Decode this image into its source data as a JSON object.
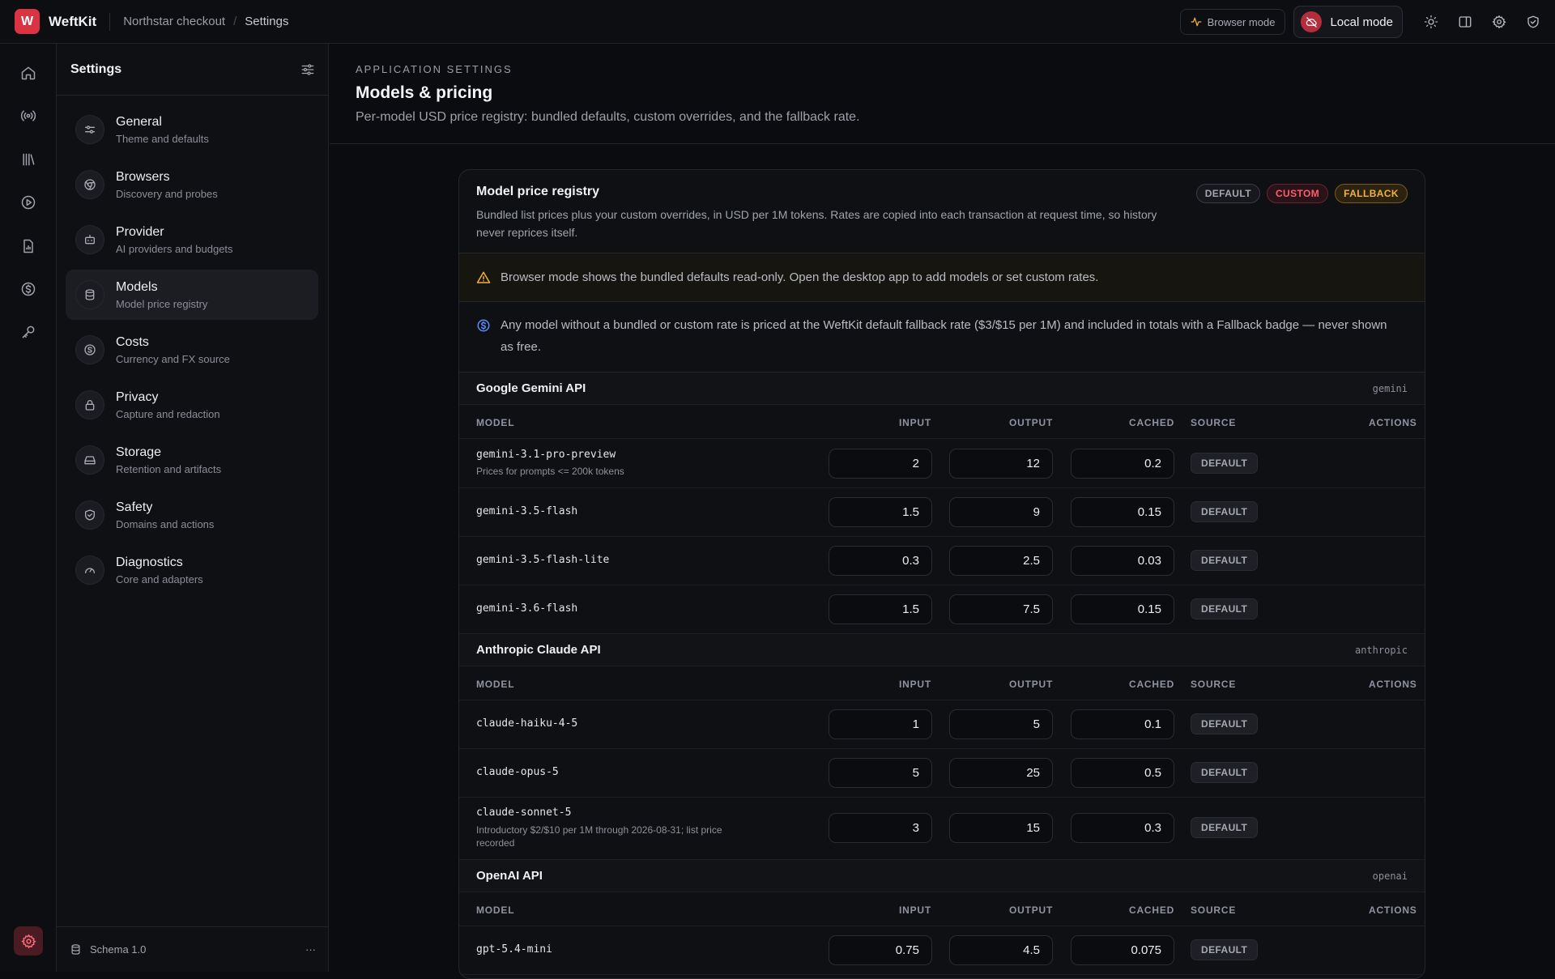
{
  "topbar": {
    "logo_letter": "W",
    "app_name": "WeftKit",
    "project": "Northstar checkout",
    "separator": "/",
    "current": "Settings",
    "browser_mode": "Browser mode",
    "local_mode": "Local mode"
  },
  "sidebar": {
    "title": "Settings",
    "items": [
      {
        "label": "General",
        "sub": "Theme and defaults",
        "icon": "sliders-icon"
      },
      {
        "label": "Browsers",
        "sub": "Discovery and probes",
        "icon": "chrome-icon"
      },
      {
        "label": "Provider",
        "sub": "AI providers and budgets",
        "icon": "robot-icon"
      },
      {
        "label": "Models",
        "sub": "Model price registry",
        "icon": "database-icon",
        "active": true
      },
      {
        "label": "Costs",
        "sub": "Currency and FX source",
        "icon": "dollar-icon"
      },
      {
        "label": "Privacy",
        "sub": "Capture and redaction",
        "icon": "lock-icon"
      },
      {
        "label": "Storage",
        "sub": "Retention and artifacts",
        "icon": "drive-icon"
      },
      {
        "label": "Safety",
        "sub": "Domains and actions",
        "icon": "shield-check-icon"
      },
      {
        "label": "Diagnostics",
        "sub": "Core and adapters",
        "icon": "gauge-icon"
      }
    ],
    "footer": "Schema 1.0",
    "footer_more": "···"
  },
  "page": {
    "eyebrow": "APPLICATION SETTINGS",
    "title": "Models & pricing",
    "description": "Per-model USD price registry: bundled defaults, custom overrides, and the fallback rate."
  },
  "card": {
    "title": "Model price registry",
    "description": "Bundled list prices plus your custom overrides, in USD per 1M tokens. Rates are copied into each transaction at request time, so history never reprices itself.",
    "badges": {
      "default": "DEFAULT",
      "custom": "CUSTOM",
      "fallback": "FALLBACK"
    },
    "warning": "Browser mode shows the bundled defaults read-only. Open the desktop app to add models or set custom rates.",
    "info": "Any model without a bundled or custom rate is priced at the WeftKit default fallback rate ($3/$15 per 1M) and included in totals with a Fallback badge — never shown as free.",
    "columns": {
      "model": "MODEL",
      "input": "INPUT",
      "output": "OUTPUT",
      "cached": "CACHED",
      "source": "SOURCE",
      "actions": "ACTIONS"
    }
  },
  "groups": [
    {
      "name": "Google Gemini API",
      "id": "gemini",
      "rows": [
        {
          "model": "gemini-3.1-pro-preview",
          "note": "Prices for prompts <= 200k tokens",
          "input": "2",
          "output": "12",
          "cached": "0.2",
          "source": "DEFAULT"
        },
        {
          "model": "gemini-3.5-flash",
          "input": "1.5",
          "output": "9",
          "cached": "0.15",
          "source": "DEFAULT"
        },
        {
          "model": "gemini-3.5-flash-lite",
          "input": "0.3",
          "output": "2.5",
          "cached": "0.03",
          "source": "DEFAULT"
        },
        {
          "model": "gemini-3.6-flash",
          "input": "1.5",
          "output": "7.5",
          "cached": "0.15",
          "source": "DEFAULT"
        }
      ]
    },
    {
      "name": "Anthropic Claude API",
      "id": "anthropic",
      "rows": [
        {
          "model": "claude-haiku-4-5",
          "input": "1",
          "output": "5",
          "cached": "0.1",
          "source": "DEFAULT"
        },
        {
          "model": "claude-opus-5",
          "input": "5",
          "output": "25",
          "cached": "0.5",
          "source": "DEFAULT"
        },
        {
          "model": "claude-sonnet-5",
          "note": "Introductory $2/$10 per 1M through 2026-08-31; list price recorded",
          "input": "3",
          "output": "15",
          "cached": "0.3",
          "source": "DEFAULT"
        }
      ]
    },
    {
      "name": "OpenAI API",
      "id": "openai",
      "rows": [
        {
          "model": "gpt-5.4-mini",
          "input": "0.75",
          "output": "4.5",
          "cached": "0.075",
          "source": "DEFAULT"
        }
      ]
    }
  ]
}
